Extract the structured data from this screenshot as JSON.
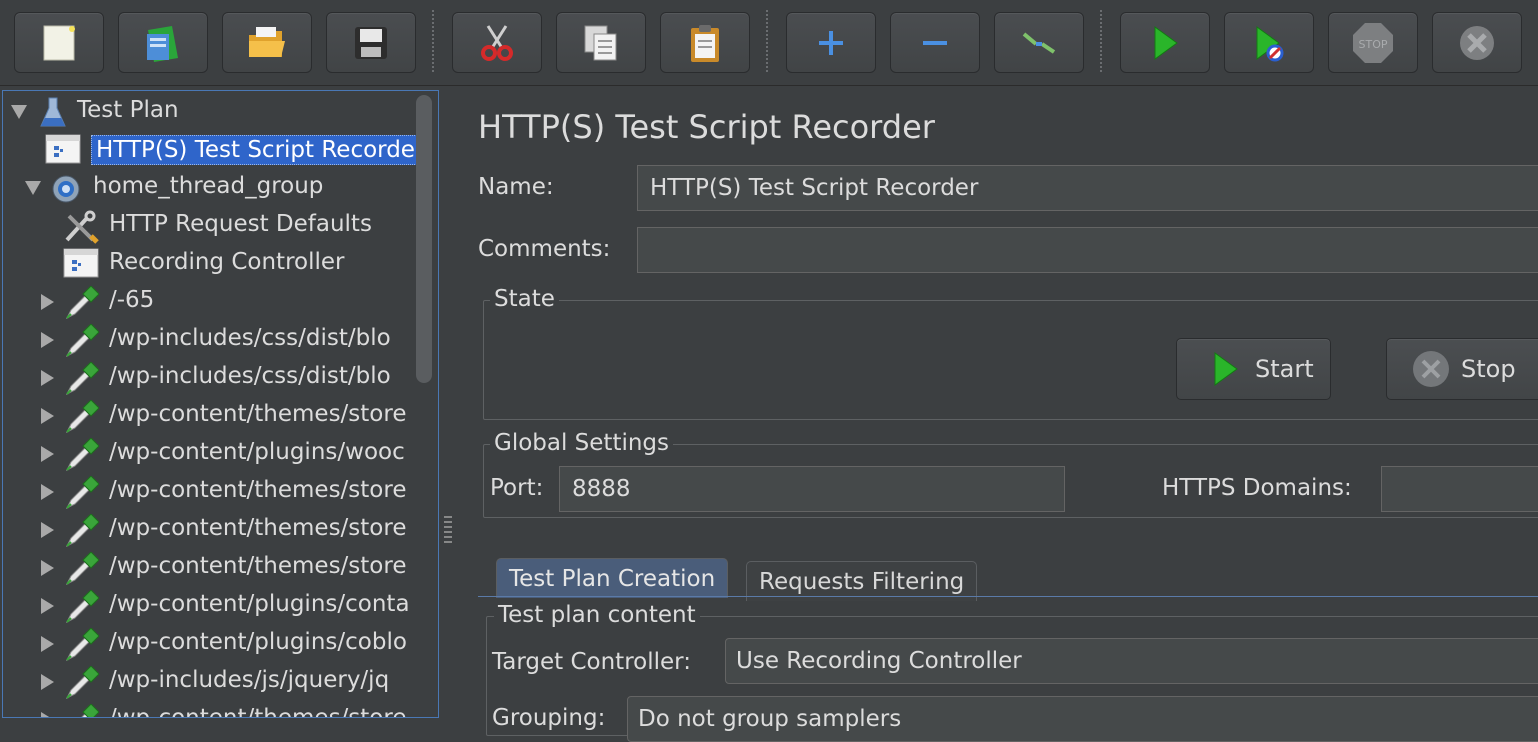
{
  "toolbar": {
    "buttons": [
      {
        "name": "new-icon"
      },
      {
        "name": "templates-icon"
      },
      {
        "name": "open-folder-icon"
      },
      {
        "name": "save-icon"
      },
      {
        "name": "cut-icon"
      },
      {
        "name": "copy-icon"
      },
      {
        "name": "paste-icon"
      },
      {
        "name": "expand-plus-icon"
      },
      {
        "name": "collapse-minus-icon"
      },
      {
        "name": "toggle-icon"
      },
      {
        "name": "start-icon"
      },
      {
        "name": "start-no-pauses-icon"
      },
      {
        "name": "stop-icon"
      },
      {
        "name": "shutdown-icon"
      }
    ]
  },
  "tree": {
    "items": [
      {
        "label": "Test Plan",
        "icon": "flask-icon",
        "expanded": true
      },
      {
        "label": "HTTP(S) Test Script Recorder",
        "icon": "recorder-icon",
        "selected": true
      },
      {
        "label": "home_thread_group",
        "icon": "gear-icon",
        "expanded": true
      },
      {
        "label": "HTTP Request Defaults",
        "icon": "wrench-icon"
      },
      {
        "label": "Recording Controller",
        "icon": "controller-icon"
      },
      {
        "label": "/-65",
        "icon": "pipette-icon"
      },
      {
        "label": "/wp-includes/css/dist/blo",
        "icon": "pipette-icon"
      },
      {
        "label": "/wp-includes/css/dist/blo",
        "icon": "pipette-icon"
      },
      {
        "label": "/wp-content/themes/store",
        "icon": "pipette-icon"
      },
      {
        "label": "/wp-content/plugins/wooc",
        "icon": "pipette-icon"
      },
      {
        "label": "/wp-content/themes/store",
        "icon": "pipette-icon"
      },
      {
        "label": "/wp-content/themes/store",
        "icon": "pipette-icon"
      },
      {
        "label": "/wp-content/themes/store",
        "icon": "pipette-icon"
      },
      {
        "label": "/wp-content/plugins/conta",
        "icon": "pipette-icon"
      },
      {
        "label": "/wp-content/plugins/coblo",
        "icon": "pipette-icon"
      },
      {
        "label": "/wp-includes/js/jquery/jq",
        "icon": "pipette-icon"
      },
      {
        "label": "/wp-content/themes/store",
        "icon": "pipette-icon"
      }
    ]
  },
  "recorder": {
    "title": "HTTP(S) Test Script Recorder",
    "name_label": "Name:",
    "name_value": "HTTP(S) Test Script Recorder",
    "comments_label": "Comments:",
    "comments_value": "",
    "state": {
      "title": "State",
      "start_label": "Start",
      "stop_label": "Stop"
    },
    "global_settings": {
      "title": "Global Settings",
      "port_label": "Port:",
      "port_value": "8888",
      "https_domains_label": "HTTPS Domains:",
      "https_domains_value": ""
    },
    "tabs": [
      {
        "label": "Test Plan Creation",
        "active": true
      },
      {
        "label": "Requests Filtering",
        "active": false
      }
    ],
    "test_plan_content": {
      "title": "Test plan content",
      "target_controller_label": "Target Controller:",
      "target_controller_value": "Use Recording Controller",
      "grouping_label": "Grouping:",
      "grouping_value": "Do not group samplers"
    }
  },
  "colors": {
    "background": "#3c3f41",
    "selection": "#2f65ca",
    "start_green": "#2ab52a"
  }
}
